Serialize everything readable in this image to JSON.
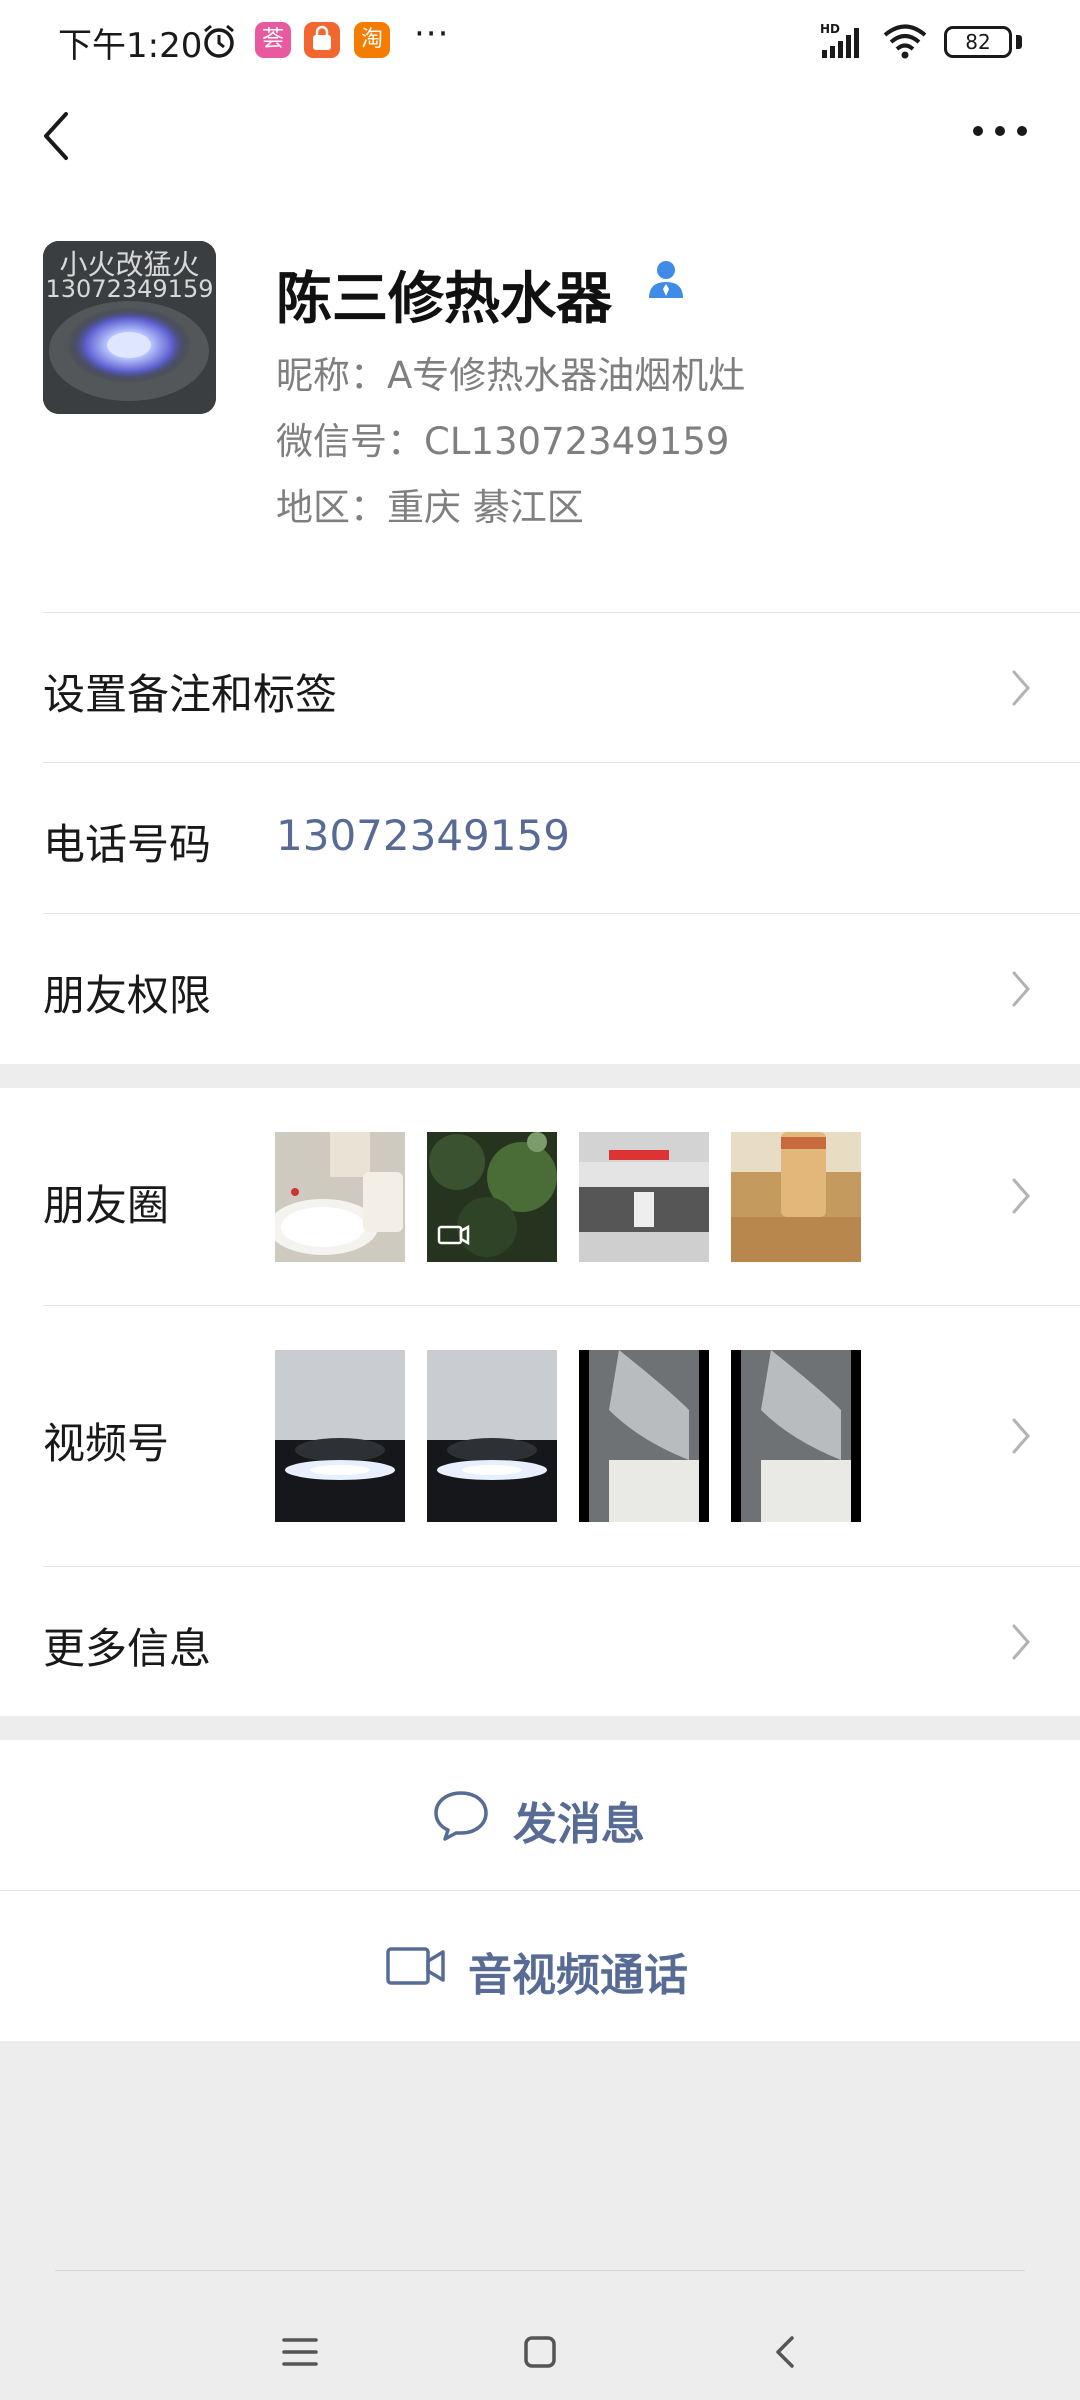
{
  "status_bar": {
    "time": "下午1:20",
    "app_badge_1": "荟",
    "app_badge_2": "淘",
    "more": "···",
    "network": "HD",
    "battery": "82"
  },
  "header": {
    "back_icon": "chevron-left-icon",
    "more_icon": "more-horizontal-icon"
  },
  "profile": {
    "avatar_text_1": "小火改猛火",
    "avatar_text_2": "13072349159",
    "name": "陈三修热水器",
    "nickname": "昵称：A专修热水器油烟机灶",
    "wechat_id": "微信号：CL13072349159",
    "region": "地区：重庆  綦江区"
  },
  "rows": {
    "remark_tags": "设置备注和标签",
    "phone_label": "电话号码",
    "phone_value": "13072349159",
    "friend_permissions": "朋友权限",
    "moments": "朋友圈",
    "channels": "视频号",
    "more_info": "更多信息"
  },
  "actions": {
    "send_message": "发消息",
    "av_call": "音视频通话"
  },
  "colors": {
    "link_blue": "#576b95",
    "verify_blue": "#3f8be7",
    "background_gray": "#ededed"
  }
}
